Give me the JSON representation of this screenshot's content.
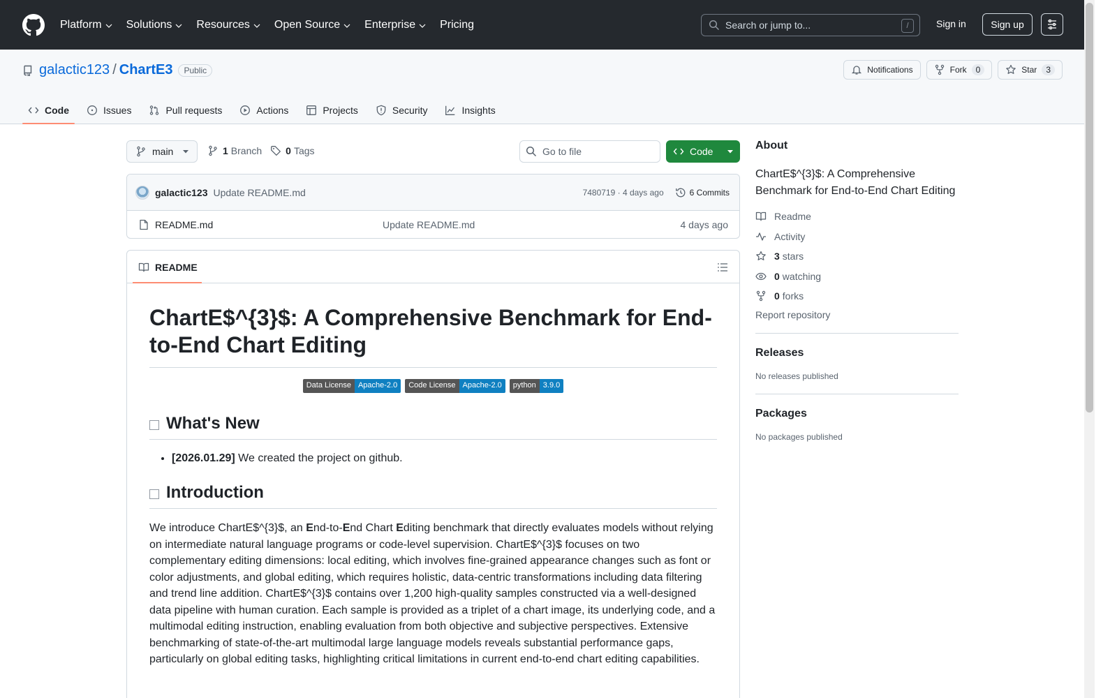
{
  "header": {
    "nav": [
      "Platform",
      "Solutions",
      "Resources",
      "Open Source",
      "Enterprise",
      "Pricing"
    ],
    "search_placeholder": "Search or jump to...",
    "search_shortcut": "/",
    "sign_in": "Sign in",
    "sign_up": "Sign up"
  },
  "repo": {
    "owner": "galactic123",
    "separator": "/",
    "name": "ChartE3",
    "visibility": "Public",
    "notifications": "Notifications",
    "fork_label": "Fork",
    "fork_count": "0",
    "star_label": "Star",
    "star_count": "3",
    "tabs": [
      "Code",
      "Issues",
      "Pull requests",
      "Actions",
      "Projects",
      "Security",
      "Insights"
    ]
  },
  "browser": {
    "branch": "main",
    "branch_count": "1",
    "branch_label": "Branch",
    "tag_count": "0",
    "tag_label": "Tags",
    "goto_placeholder": "Go to file",
    "code_button": "Code",
    "commit": {
      "author": "galactic123",
      "message": "Update README.md",
      "meta": "7480719 · 4 days ago",
      "commits": "6 Commits"
    },
    "files": [
      {
        "name": "README.md",
        "commit": "Update README.md",
        "date": "4 days ago"
      }
    ]
  },
  "readme": {
    "tab": "README",
    "title": "ChartE$^{3}$: A Comprehensive Benchmark for End-to-End Chart Editing",
    "badges": [
      {
        "label": "Data License",
        "value": "Apache-2.0",
        "color": "#0f80c1"
      },
      {
        "label": "Code License",
        "value": "Apache-2.0",
        "color": "#0f80c1"
      },
      {
        "label": "python",
        "value": "3.9.0",
        "color": "#0f80c1"
      }
    ],
    "whats_new_heading": "What's New",
    "news": [
      {
        "date": "[2026.01.29]",
        "text": " We created the project on github."
      }
    ],
    "intro_heading": "Introduction",
    "intro_parts": [
      "We introduce ChartE$^{3}$, an ",
      "E",
      "nd-to-",
      "E",
      "nd Chart ",
      "E",
      "diting benchmark that directly evaluates models without relying on intermediate natural language programs or code-level supervision. ChartE$^{3}$ focuses on two complementary editing dimensions: local editing, which involves fine-grained appearance changes such as font or color adjustments, and global editing, which requires holistic, data-centric transformations including data filtering and trend line addition. ChartE$^{3}$ contains over 1,200 high-quality samples constructed via a well-designed data pipeline with human curation. Each sample is provided as a triplet of a chart image, its underlying code, and a multimodal editing instruction, enabling evaluation from both objective and subjective perspectives. Extensive benchmarking of state-of-the-art multimodal large language models reveals substantial performance gaps, particularly on global editing tasks, highlighting critical limitations in current end-to-end chart editing capabilities."
    ]
  },
  "sidebar": {
    "about_heading": "About",
    "description": "ChartE$^{3}$: A Comprehensive Benchmark for End-to-End Chart Editing",
    "readme": "Readme",
    "activity": "Activity",
    "stars_count": "3",
    "stars_label": "stars",
    "watching_count": "0",
    "watching_label": "watching",
    "forks_count": "0",
    "forks_label": "forks",
    "report": "Report repository",
    "releases_heading": "Releases",
    "releases_none": "No releases published",
    "packages_heading": "Packages",
    "packages_none": "No packages published"
  },
  "colors": {
    "header_bg": "#25292e",
    "link": "#0969da",
    "primary_button": "#1f883d",
    "tab_underline": "#fd8c73"
  }
}
